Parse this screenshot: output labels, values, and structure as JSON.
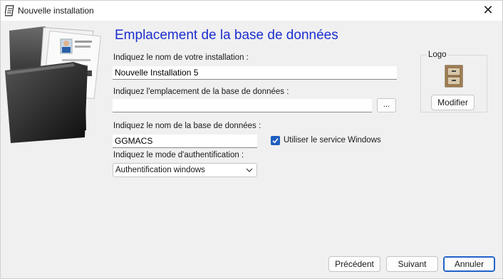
{
  "window": {
    "title": "Nouvelle installation",
    "close_symbol": "✕",
    "icon": "notebook-icon"
  },
  "main": {
    "heading": "Emplacement de la base de données",
    "install_name_label": "Indiquez le nom de votre installation :",
    "install_name_value": "Nouvelle Installation 5",
    "db_location_label": "Indiquez l'emplacement de la base de données :",
    "db_location_value": "",
    "browse_label": "...",
    "db_name_label": "Indiquez le nom de la base de données :",
    "db_name_value": "GGMACS",
    "windows_service_label": "Utiliser le service Windows",
    "windows_service_checked": true,
    "auth_mode_label": "Indiquez le mode d'authentification :",
    "auth_mode_value": "Authentification windows"
  },
  "logo": {
    "title": "Logo",
    "image_icon": "filing-cabinet-icon",
    "modify_label": "Modifier"
  },
  "footer": {
    "previous_label": "Précédent",
    "next_label": "Suivant",
    "cancel_label": "Annuler"
  },
  "colors": {
    "heading": "#1c2fd0",
    "accent": "#1f5fbf",
    "window_bg": "#f0f0f0"
  }
}
